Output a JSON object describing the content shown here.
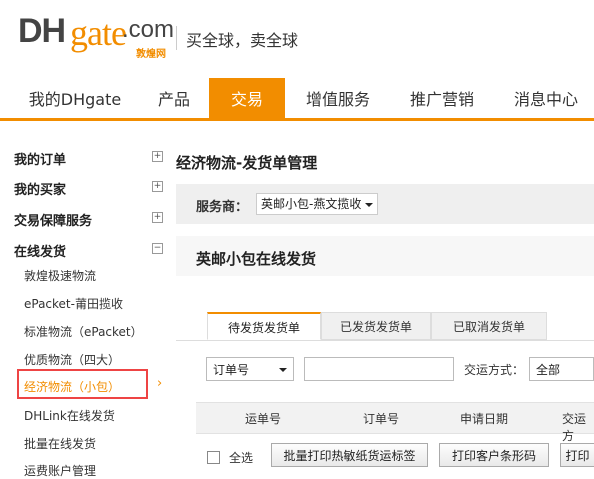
{
  "header": {
    "logo_dh": "DH",
    "logo_gate": "gate",
    "logo_com": ".com",
    "logo_cn": "敦煌网",
    "slogan": "买全球，卖全球"
  },
  "nav": {
    "tabs": [
      "我的DHgate",
      "产品",
      "交易",
      "增值服务",
      "推广营销",
      "消息中心"
    ],
    "active": "交易"
  },
  "sidebar": {
    "groups": [
      "我的订单",
      "我的买家",
      "交易保障服务",
      "在线发货"
    ],
    "expand_signs": [
      "+",
      "+",
      "+",
      "−"
    ],
    "items": [
      "敦煌极速物流",
      "ePacket-莆田揽收",
      "标准物流（ePacket）",
      "优质物流（四大）",
      "经济物流（小包）",
      "DHLink在线发货",
      "批量在线发货",
      "运费账户管理"
    ],
    "selected_arrow": "›"
  },
  "main": {
    "title": "经济物流-发货单管理",
    "service_label": "服务商：",
    "service_value": "英邮小包-燕文揽收",
    "panel_title": "英邮小包在线发货",
    "tabs": [
      "待发货发货单",
      "已发货发货单",
      "已取消发货单"
    ],
    "filter": {
      "field_select": "订单号",
      "shipping_label": "交运方式：",
      "shipping_value": "全部"
    },
    "table_headers": [
      "运单号",
      "订单号",
      "申请日期",
      "交运方"
    ],
    "select_all_label": "全选",
    "buttons": [
      "批量打印热敏纸货运标签",
      "打印客户条形码",
      "打印"
    ]
  }
}
